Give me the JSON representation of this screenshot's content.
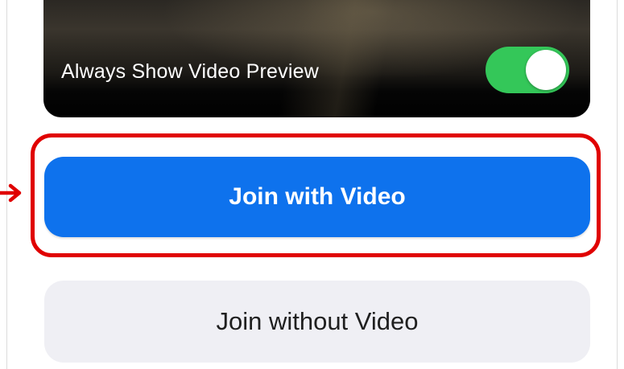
{
  "preview": {
    "label": "Always Show Video Preview",
    "toggle_on": true
  },
  "buttons": {
    "join_with_video": "Join with Video",
    "join_without_video": "Join without Video"
  },
  "colors": {
    "primary_blue": "#0e72ed",
    "toggle_green": "#34c759",
    "highlight_red": "#e00000",
    "secondary_button_bg": "#efeff4"
  },
  "annotation": {
    "icon": "arrow-right-icon"
  }
}
